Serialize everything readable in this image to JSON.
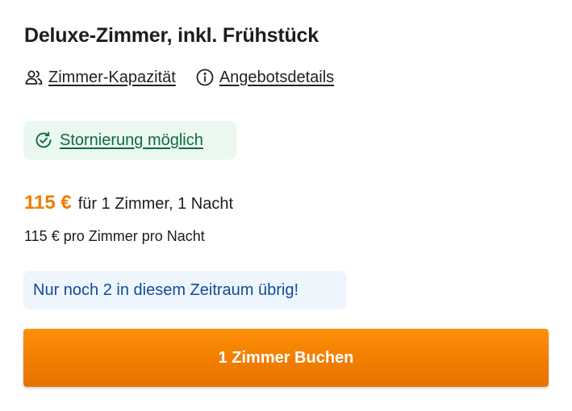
{
  "room": {
    "title": "Deluxe-Zimmer, inkl. Frühstück"
  },
  "links": {
    "capacity": {
      "label": "Zimmer-Kapazität",
      "icon": "users-icon"
    },
    "offer_details": {
      "label": "Angebotsdetails",
      "icon": "info-icon"
    }
  },
  "cancellation": {
    "label": "Stornierung möglich",
    "icon": "refresh-check-icon",
    "color": "#0f6b3b",
    "background": "#eaf8f0"
  },
  "price": {
    "amount": "115 €",
    "description": "für 1 Zimmer, 1 Nacht",
    "per_night": "115 € pro Zimmer pro Nacht",
    "color": "#f07c00"
  },
  "availability": {
    "text": "Nur noch 2 in diesem Zeitraum übrig!",
    "color": "#0f4c96",
    "background": "#eef5fd"
  },
  "booking": {
    "button_label": "1 Zimmer Buchen",
    "color": "#f07c00"
  }
}
